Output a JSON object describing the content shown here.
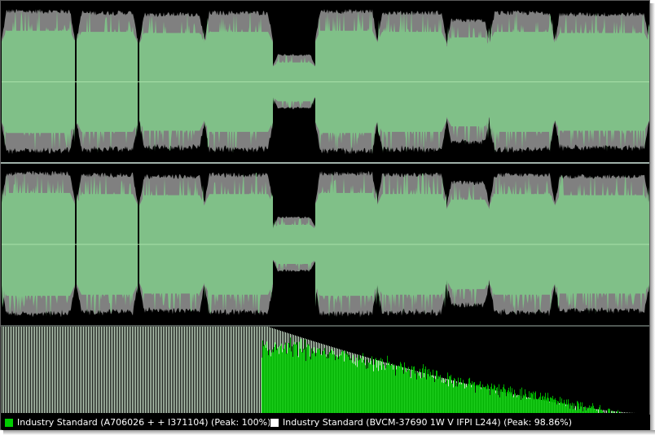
{
  "colors": {
    "background": "#000000",
    "waveform_fill": "#80c088",
    "waveform_peak": "#808080",
    "waveform_rms_line": "#a8e0a8",
    "separator": "#9fb0a8",
    "spectrum_light": "#d8f0d8",
    "spectrum_bright": "#00cc00"
  },
  "icons": {
    "series_a_swatch": "green-square",
    "series_b_swatch": "white-square"
  },
  "legend": {
    "series_a": {
      "label": "Industry Standard (A706026 + + I371104) (Peak: 100%)",
      "color": "#00cc00"
    },
    "series_b": {
      "label": "Industry Standard (BVCM-37690 1W V IFPI L244) (Peak: 98.86%)",
      "color": "#ffffff"
    }
  },
  "waveform": {
    "channels": [
      "left",
      "right"
    ],
    "segment_levels": [
      0.92,
      0.9,
      0.88,
      0.9,
      0.35,
      0.92,
      0.9,
      0.8,
      0.9,
      0.88
    ]
  }
}
